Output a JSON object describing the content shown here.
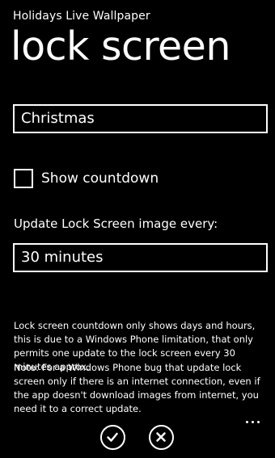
{
  "header": {
    "app_title": "Holidays Live Wallpaper",
    "page_title": "lock screen"
  },
  "form": {
    "holiday_value": "Christmas",
    "countdown_label": "Show countdown",
    "countdown_checked": false,
    "update_label": "Update Lock Screen image every:",
    "interval_value": "30 minutes"
  },
  "info": {
    "paragraph_1": "Lock screen countdown only shows days and hours, this is due to a Windows Phone limitation, that only permits one update to the lock screen every 30 minutes approx.",
    "paragraph_2": "Note: For a Windows Phone bug that update lock screen only if there is an internet connection, even if the app doesn't download images from internet, you need it to a correct update."
  },
  "app_bar": {
    "buttons": [
      {
        "icon": "check-icon"
      },
      {
        "icon": "close-icon"
      }
    ],
    "menu_icon": "more-icon"
  },
  "colors": {
    "background": "#000000",
    "foreground": "#ffffff"
  }
}
